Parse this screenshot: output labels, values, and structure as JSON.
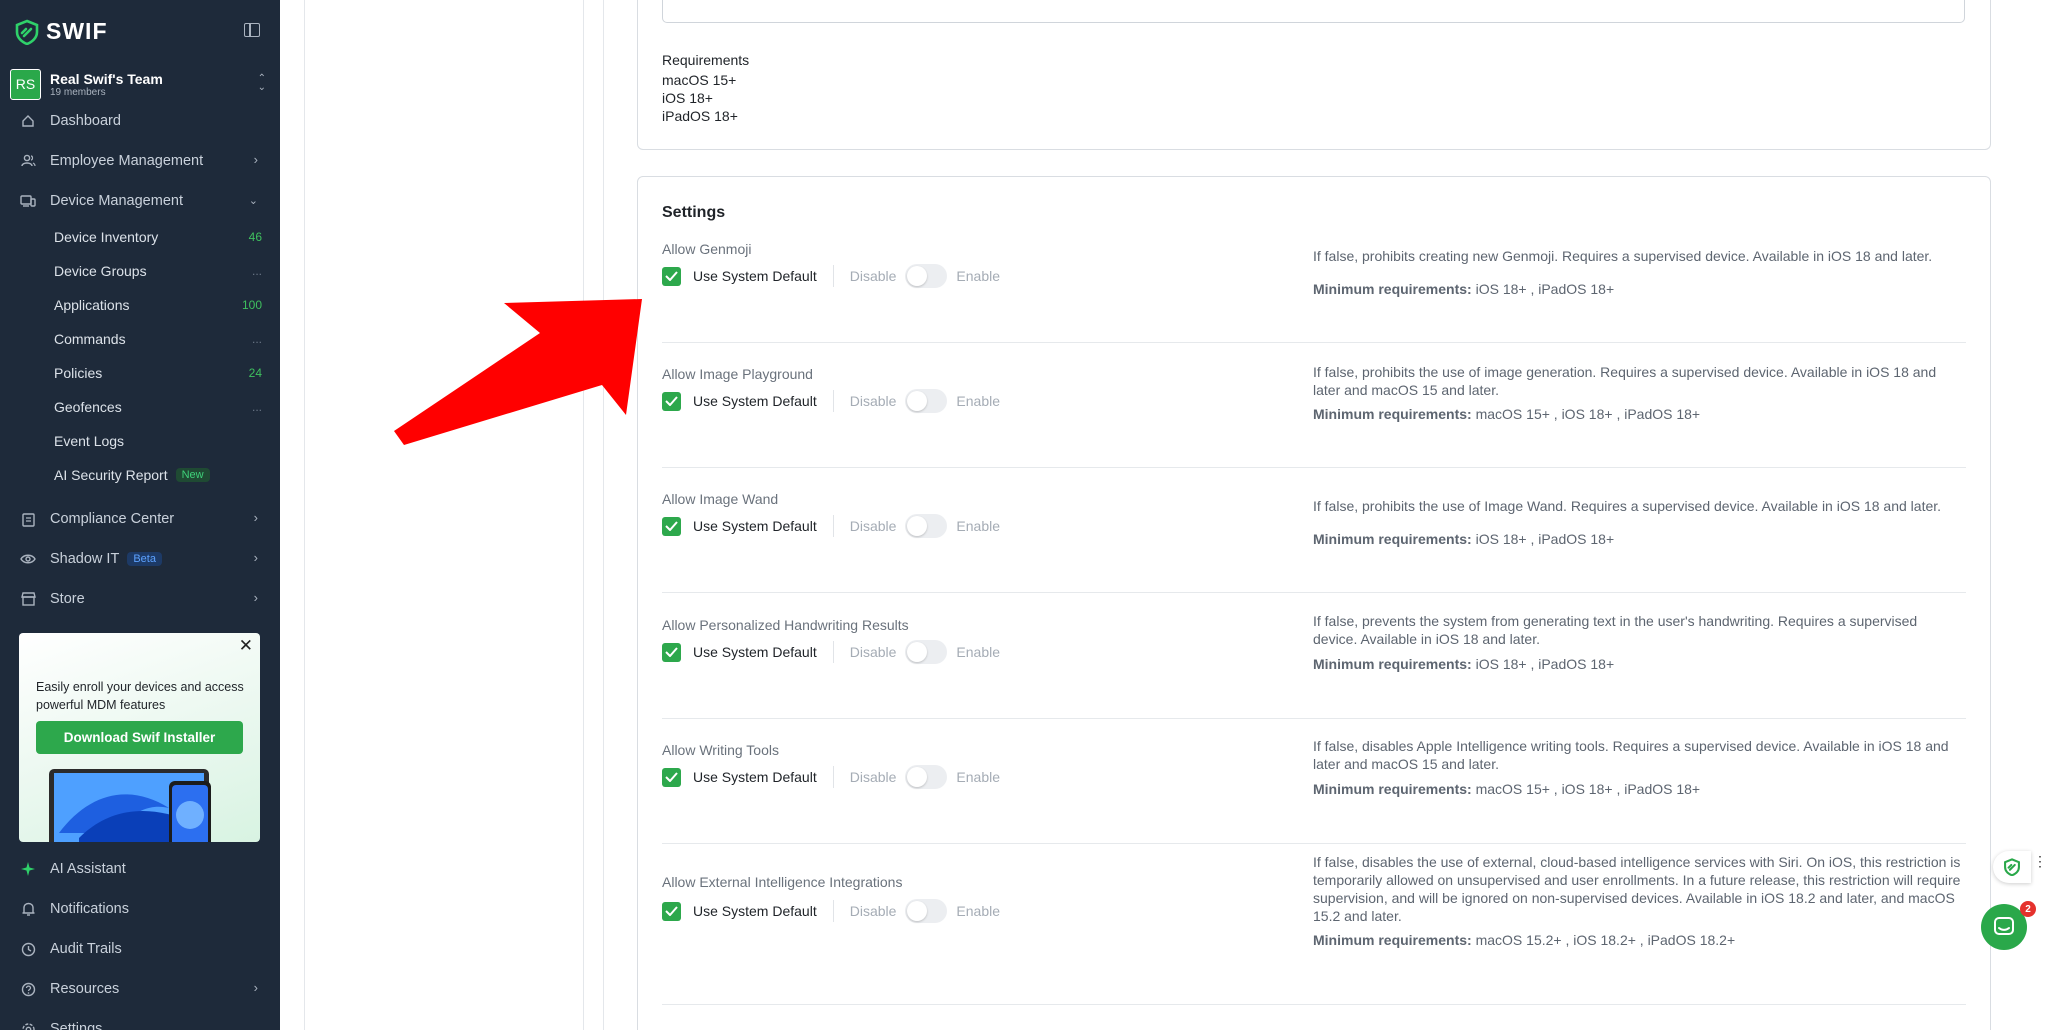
{
  "app": {
    "logo": "SWIF",
    "team_name": "Real Swif's Team",
    "team_members": "19 members",
    "team_initials": "RS"
  },
  "nav": {
    "dashboard": "Dashboard",
    "employee_management": "Employee Management",
    "device_management": "Device Management",
    "device_sub": [
      {
        "label": "Device Inventory",
        "count": "46"
      },
      {
        "label": "Device Groups",
        "count": "..."
      },
      {
        "label": "Applications",
        "count": "100"
      },
      {
        "label": "Commands",
        "count": "..."
      },
      {
        "label": "Policies",
        "count": "24"
      },
      {
        "label": "Geofences",
        "count": "..."
      },
      {
        "label": "Event Logs",
        "count": ""
      },
      {
        "label": "AI Security Report",
        "badge": "New"
      }
    ],
    "compliance_center": "Compliance Center",
    "shadow_it": "Shadow IT",
    "shadow_it_badge": "Beta",
    "store": "Store",
    "ai_assistant": "AI Assistant",
    "notifications": "Notifications",
    "audit_trails": "Audit Trails",
    "resources": "Resources",
    "settings": "Settings"
  },
  "promo": {
    "text": "Easily enroll your devices and access powerful MDM features",
    "button": "Download Swif Installer"
  },
  "requirements": {
    "title": "Requirements",
    "items": [
      "macOS 15+",
      "iOS 18+",
      "iPadOS 18+"
    ]
  },
  "settings": {
    "title": "Settings",
    "checkbox_label": "Use System Default",
    "disable_label": "Disable",
    "enable_label": "Enable",
    "min_req_label": "Minimum requirements:",
    "rows": [
      {
        "label": "Allow Genmoji",
        "desc": "If false, prohibits creating new Genmoji. Requires a supervised device. Available in iOS 18 and later.",
        "req": "iOS 18+ , iPadOS 18+"
      },
      {
        "label": "Allow Image Playground",
        "desc": "If false, prohibits the use of image generation. Requires a supervised device. Available in iOS 18 and later and macOS 15 and later.",
        "req": "macOS 15+ , iOS 18+ , iPadOS 18+"
      },
      {
        "label": "Allow Image Wand",
        "desc": "If false, prohibits the use of Image Wand. Requires a supervised device. Available in iOS 18 and later.",
        "req": "iOS 18+ , iPadOS 18+"
      },
      {
        "label": "Allow Personalized Handwriting Results",
        "desc": "If false, prevents the system from generating text in the user's handwriting. Requires a supervised device. Available in iOS 18 and later.",
        "req": "iOS 18+ , iPadOS 18+"
      },
      {
        "label": "Allow Writing Tools",
        "desc": "If false, disables Apple Intelligence writing tools. Requires a supervised device. Available in iOS 18 and later and macOS 15 and later.",
        "req": "macOS 15+ , iOS 18+ , iPadOS 18+"
      },
      {
        "label": "Allow External Intelligence Integrations",
        "desc": "If false, disables the use of external, cloud-based intelligence services with Siri. On iOS, this restriction is temporarily allowed on unsupervised and user enrollments. In a future release, this restriction will require supervision, and will be ignored on non-supervised devices. Available in iOS 18.2 and later, and macOS 15.2 and later.",
        "req": "macOS 15.2+ , iOS 18.2+ , iPadOS 18.2+"
      }
    ]
  },
  "chat": {
    "badge": "2"
  },
  "colors": {
    "sidebar_bg": "#1e2a3a",
    "accent_green": "#2da84c",
    "arrow_red": "#ff0000"
  }
}
